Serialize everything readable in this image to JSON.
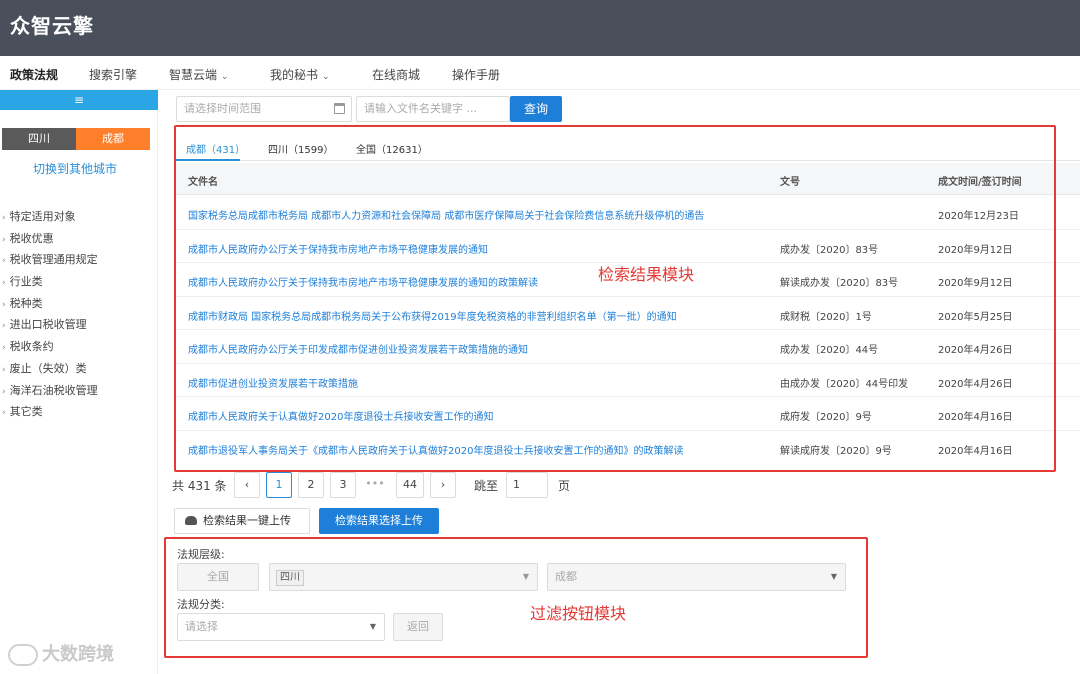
{
  "header": {
    "logo": "众智云擎"
  },
  "nav": {
    "items": [
      {
        "label": "政策法规",
        "active": true
      },
      {
        "label": "搜索引擎"
      },
      {
        "label": "智慧云端",
        "dropdown": true
      },
      {
        "label": "我的秘书",
        "dropdown": true
      },
      {
        "label": "在线商城"
      },
      {
        "label": "操作手册"
      }
    ]
  },
  "sidebar": {
    "toggle_icon": "≡",
    "province": "四川",
    "city": "成都",
    "switch_city": "切换到其他城市",
    "categories": [
      "特定适用对象",
      "税收优惠",
      "税收管理通用规定",
      "行业类",
      "税种类",
      "进出口税收管理",
      "税收条约",
      "废止（失效）类",
      "海洋石油税收管理",
      "其它类"
    ]
  },
  "search": {
    "date_placeholder": "请选择时间范围",
    "keyword_placeholder": "请输入文件名关键字 ...",
    "query_label": "查询"
  },
  "results": {
    "tabs": [
      "成都（431）",
      "四川（1599）",
      "全国（12631）"
    ],
    "columns": [
      "文件名",
      "文号",
      "成文时间/签订时间"
    ],
    "rows": [
      {
        "name": "国家税务总局成都市税务局 成都市人力资源和社会保障局 成都市医疗保障局关于社会保险费信息系统升级停机的通告",
        "doc": "",
        "date": "2020年12月23日"
      },
      {
        "name": "成都市人民政府办公厅关于保持我市房地产市场平稳健康发展的通知",
        "doc": "成办发〔2020〕83号",
        "date": "2020年9月12日"
      },
      {
        "name": "成都市人民政府办公厅关于保持我市房地产市场平稳健康发展的通知的政策解读",
        "doc": "解读成办发〔2020〕83号",
        "date": "2020年9月12日"
      },
      {
        "name": "成都市财政局 国家税务总局成都市税务局关于公布获得2019年度免税资格的非营利组织名单（第一批）的通知",
        "doc": "成财税〔2020〕1号",
        "date": "2020年5月25日"
      },
      {
        "name": "成都市人民政府办公厅关于印发成都市促进创业投资发展若干政策措施的通知",
        "doc": "成办发〔2020〕44号",
        "date": "2020年4月26日"
      },
      {
        "name": "成都市促进创业投资发展若干政策措施",
        "doc": "由成办发〔2020〕44号印发",
        "date": "2020年4月26日"
      },
      {
        "name": "成都市人民政府关于认真做好2020年度退役士兵接收安置工作的通知",
        "doc": "成府发〔2020〕9号",
        "date": "2020年4月16日"
      },
      {
        "name": "成都市退役军人事务局关于《成都市人民政府关于认真做好2020年度退役士兵接收安置工作的通知》的政策解读",
        "doc": "解读成府发〔2020〕9号",
        "date": "2020年4月16日"
      }
    ],
    "annotation": "检索结果模块"
  },
  "pagination": {
    "total": "共 431 条",
    "prev": "‹",
    "pages": [
      "1",
      "2",
      "3",
      "•••",
      "44"
    ],
    "next": "›",
    "jump_label": "跳至",
    "jump_value": "1",
    "page_suffix": "页"
  },
  "uploads": {
    "one_click": "检索结果一键上传",
    "select": "检索结果选择上传"
  },
  "filter": {
    "level_label": "法规层级:",
    "national": "全国",
    "province_tag": "四川",
    "city_select": "成都",
    "category_label": "法规分类:",
    "category_placeholder": "请选择",
    "back": "返回",
    "annotation": "过滤按钮模块"
  },
  "watermark": "大数跨境",
  "colors": {
    "accent": "#1e7fd8",
    "annotation": "#e53935",
    "city_tab": "#ff7f2a",
    "header": "#4a4f5c"
  }
}
